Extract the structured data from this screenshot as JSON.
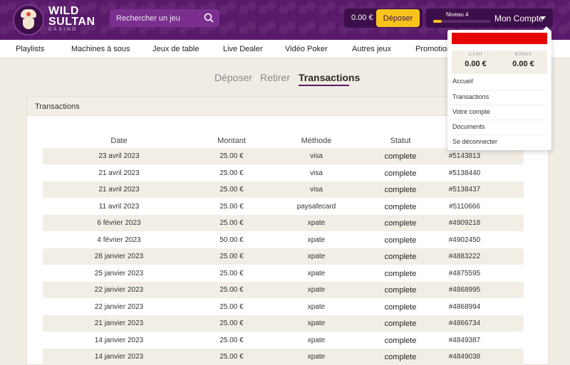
{
  "header": {
    "logo": {
      "line1": "WILD",
      "line2": "SULTAN",
      "line3": "CASINO"
    },
    "search": {
      "placeholder": "Rechercher un jeu"
    },
    "balance": "0.00 €",
    "deposit_label": "Déposer",
    "level_label": "Niveau 4",
    "level_progress": 0.15,
    "account_label": "Mon Compte"
  },
  "nav": {
    "items": [
      {
        "label": "Playlists"
      },
      {
        "label": "Machines à sous"
      },
      {
        "label": "Jeux de table"
      },
      {
        "label": "Live Dealer"
      },
      {
        "label": "Vidéo Poker"
      },
      {
        "label": "Autres jeux"
      },
      {
        "label": "Promotions"
      }
    ]
  },
  "tabs": [
    {
      "label": "Déposer"
    },
    {
      "label": "Retirer"
    },
    {
      "label": "Transactions",
      "active": true
    }
  ],
  "panel": {
    "title": "Transactions",
    "columns": [
      "Date",
      "Montant",
      "Méthode",
      "Statut",
      ""
    ],
    "rows": [
      {
        "date": "23 avril 2023",
        "amount": "25.00 €",
        "method": "visa",
        "status": "complete",
        "id": "#5143813"
      },
      {
        "date": "21 avril 2023",
        "amount": "25.00 €",
        "method": "visa",
        "status": "complete",
        "id": "#5138440"
      },
      {
        "date": "21 avril 2023",
        "amount": "25.00 €",
        "method": "visa",
        "status": "complete",
        "id": "#5138437"
      },
      {
        "date": "11 avril 2023",
        "amount": "25.00 €",
        "method": "paysafecard",
        "status": "complete",
        "id": "#5110666"
      },
      {
        "date": "6 février 2023",
        "amount": "25.00 €",
        "method": "xpate",
        "status": "complete",
        "id": "#4909218"
      },
      {
        "date": "4 février 2023",
        "amount": "50.00 €",
        "method": "xpate",
        "status": "complete",
        "id": "#4902450"
      },
      {
        "date": "28 janvier 2023",
        "amount": "25.00 €",
        "method": "xpate",
        "status": "complete",
        "id": "#4883222"
      },
      {
        "date": "25 janvier 2023",
        "amount": "25.00 €",
        "method": "xpate",
        "status": "complete",
        "id": "#4875595"
      },
      {
        "date": "22 janvier 2023",
        "amount": "25.00 €",
        "method": "xpate",
        "status": "complete",
        "id": "#4868995"
      },
      {
        "date": "22 janvier 2023",
        "amount": "25.00 €",
        "method": "xpate",
        "status": "complete",
        "id": "#4868994"
      },
      {
        "date": "21 janvier 2023",
        "amount": "25.00 €",
        "method": "xpate",
        "status": "complete",
        "id": "#4866734"
      },
      {
        "date": "14 janvier 2023",
        "amount": "25.00 €",
        "method": "xpate",
        "status": "complete",
        "id": "#4849387"
      },
      {
        "date": "14 janvier 2023",
        "amount": "25.00 €",
        "method": "xpate",
        "status": "complete",
        "id": "#4849038"
      }
    ]
  },
  "dropdown": {
    "cash_label": "CASH",
    "cash_value": "0.00 €",
    "bonus_label": "BONUS",
    "bonus_value": "0.00 €",
    "items": [
      {
        "label": "Accueil"
      },
      {
        "label": "Transactions"
      },
      {
        "label": "Votre compte"
      },
      {
        "label": "Documents"
      },
      {
        "label": "Se déconnecter"
      }
    ]
  },
  "colors": {
    "header_purple": "#5a1a6b",
    "accent_yellow": "#f7c31c",
    "redaction_red": "#e60000"
  }
}
